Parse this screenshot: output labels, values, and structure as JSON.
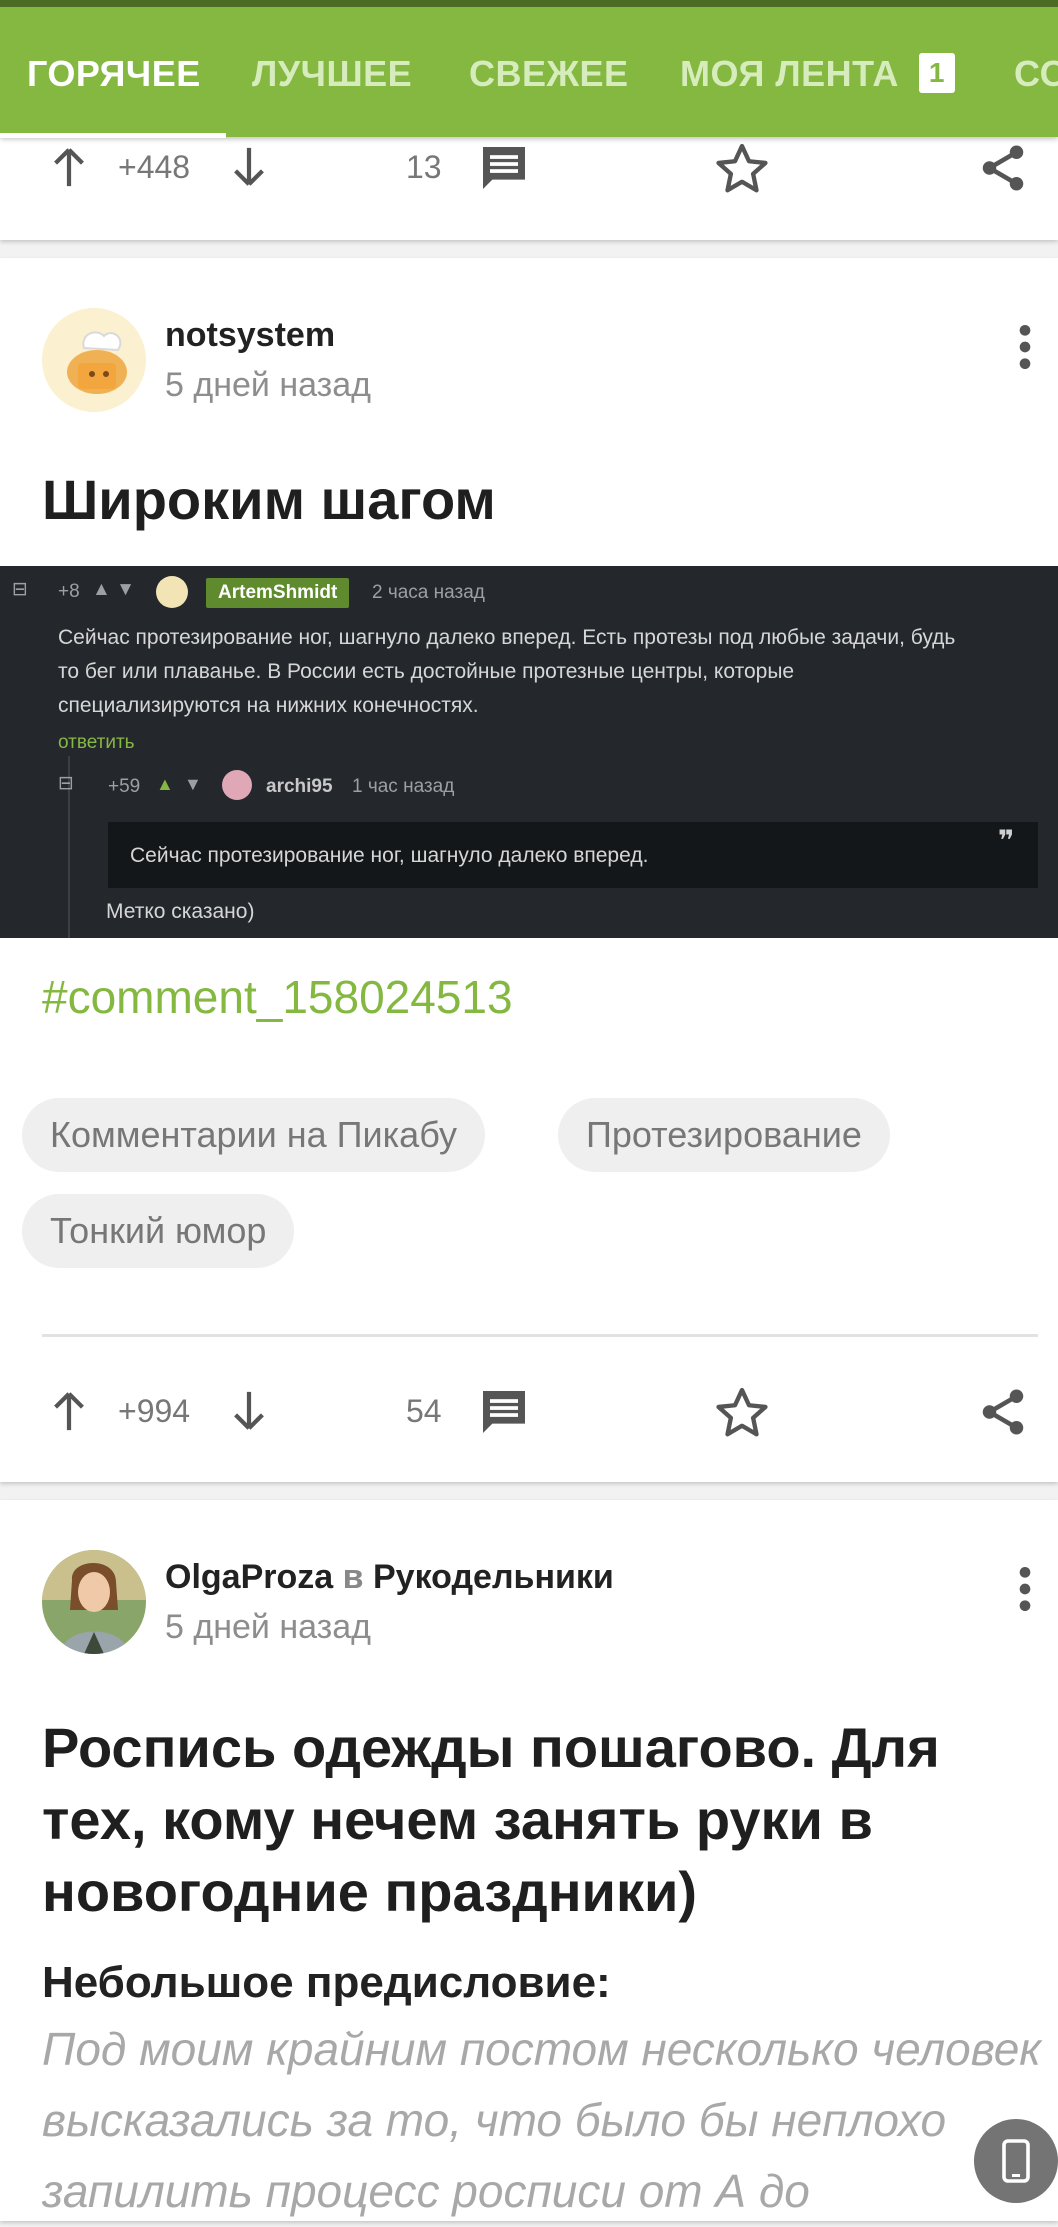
{
  "nav": {
    "tabs": [
      {
        "label": "ГОРЯЧЕЕ",
        "active": true
      },
      {
        "label": "ЛУЧШЕЕ"
      },
      {
        "label": "СВЕЖЕЕ"
      },
      {
        "label": "МОЯ ЛЕНТА",
        "badge": "1"
      },
      {
        "label": "СО"
      }
    ],
    "colors": {
      "bar": "#84b840",
      "strip": "#4c6b24",
      "inactive_tab": "#d7ecbd"
    }
  },
  "posts": [
    {
      "rating": "+448",
      "comments_count": "13",
      "icons": [
        "arrow-up-icon",
        "arrow-down-icon",
        "comment-icon",
        "star-icon",
        "share-icon"
      ]
    },
    {
      "author": "notsystem",
      "time": "5 дней назад",
      "title": "Широким шагом",
      "screenshot": {
        "c1_score": "+8",
        "c1_user": "ArtemShmidt",
        "c1_time": "2 часа назад",
        "c1_line1": "Сейчас протезирование ног, шагнуло далеко вперед. Есть протезы под любые задачи, будь",
        "c1_line2": "то бег или плаванье. В России есть достойные протезные центры, которые",
        "c1_line3": "специализируются на нижних конечностях.",
        "reply": "ответить",
        "c2_score": "+59",
        "c2_user": "archi95",
        "c2_time": "1 час назад",
        "c2_quote": "Сейчас протезирование ног, шагнуло далеко вперед.",
        "c2_text": "Метко сказано)"
      },
      "link": "#comment_158024513",
      "tags": [
        "Комментарии на Пикабу",
        "Протезирование",
        "Тонкий юмор"
      ],
      "rating": "+994",
      "comments_count": "54"
    },
    {
      "author": "OlgaProza",
      "community_prefix": "в",
      "community": "Рукодельники",
      "time": "5 дней назад",
      "title": "Роспись одежды пошагово. Для тех, кому нечем занять руки в новогодние праздники)",
      "subheading": "Небольшое предисловие:",
      "intro": "Под моим крайним постом несколько человек высказались за то, что было бы неплохо запилить процесс росписи от А до"
    }
  ]
}
